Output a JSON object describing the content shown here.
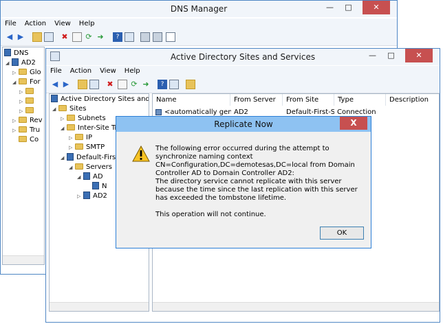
{
  "dns_window": {
    "title": "DNS Manager",
    "menu": [
      "File",
      "Action",
      "View",
      "Help"
    ],
    "tree": [
      {
        "label": "DNS"
      },
      {
        "label": "AD2"
      },
      {
        "label": "Glo"
      },
      {
        "label": "For"
      },
      {
        "label": ""
      },
      {
        "label": ""
      },
      {
        "label": ""
      },
      {
        "label": "Rev"
      },
      {
        "label": "Tru"
      },
      {
        "label": "Co"
      }
    ]
  },
  "adss_window": {
    "title": "Active Directory Sites and Services",
    "menu": [
      "File",
      "Action",
      "View",
      "Help"
    ],
    "tree": [
      {
        "label": "Active Directory Sites and Servic"
      },
      {
        "label": "Sites"
      },
      {
        "label": "Subnets"
      },
      {
        "label": "Inter-Site Tra"
      },
      {
        "label": "IP"
      },
      {
        "label": "SMTP"
      },
      {
        "label": "Default-First-"
      },
      {
        "label": "Servers"
      },
      {
        "label": "AD"
      },
      {
        "label": "N"
      },
      {
        "label": "AD2"
      }
    ],
    "list": {
      "columns": [
        "Name",
        "From Server",
        "From Site",
        "Type",
        "Description"
      ],
      "rows": [
        {
          "name": "<automatically gener...",
          "from_server": "AD2",
          "from_site": "Default-First-Si...",
          "type": "Connection",
          "description": ""
        }
      ]
    }
  },
  "dialog": {
    "title": "Replicate Now",
    "close_glyph": "X",
    "lines": [
      "The following error occurred during the attempt to synchronize naming context CN=Configuration,DC=demotesas,DC=local from Domain Controller AD to Domain Controller AD2:",
      "The directory service cannot replicate with this server because the time since the last replication with this server has exceeded the tombstone lifetime.",
      "This operation will not continue."
    ],
    "ok_label": "OK"
  }
}
